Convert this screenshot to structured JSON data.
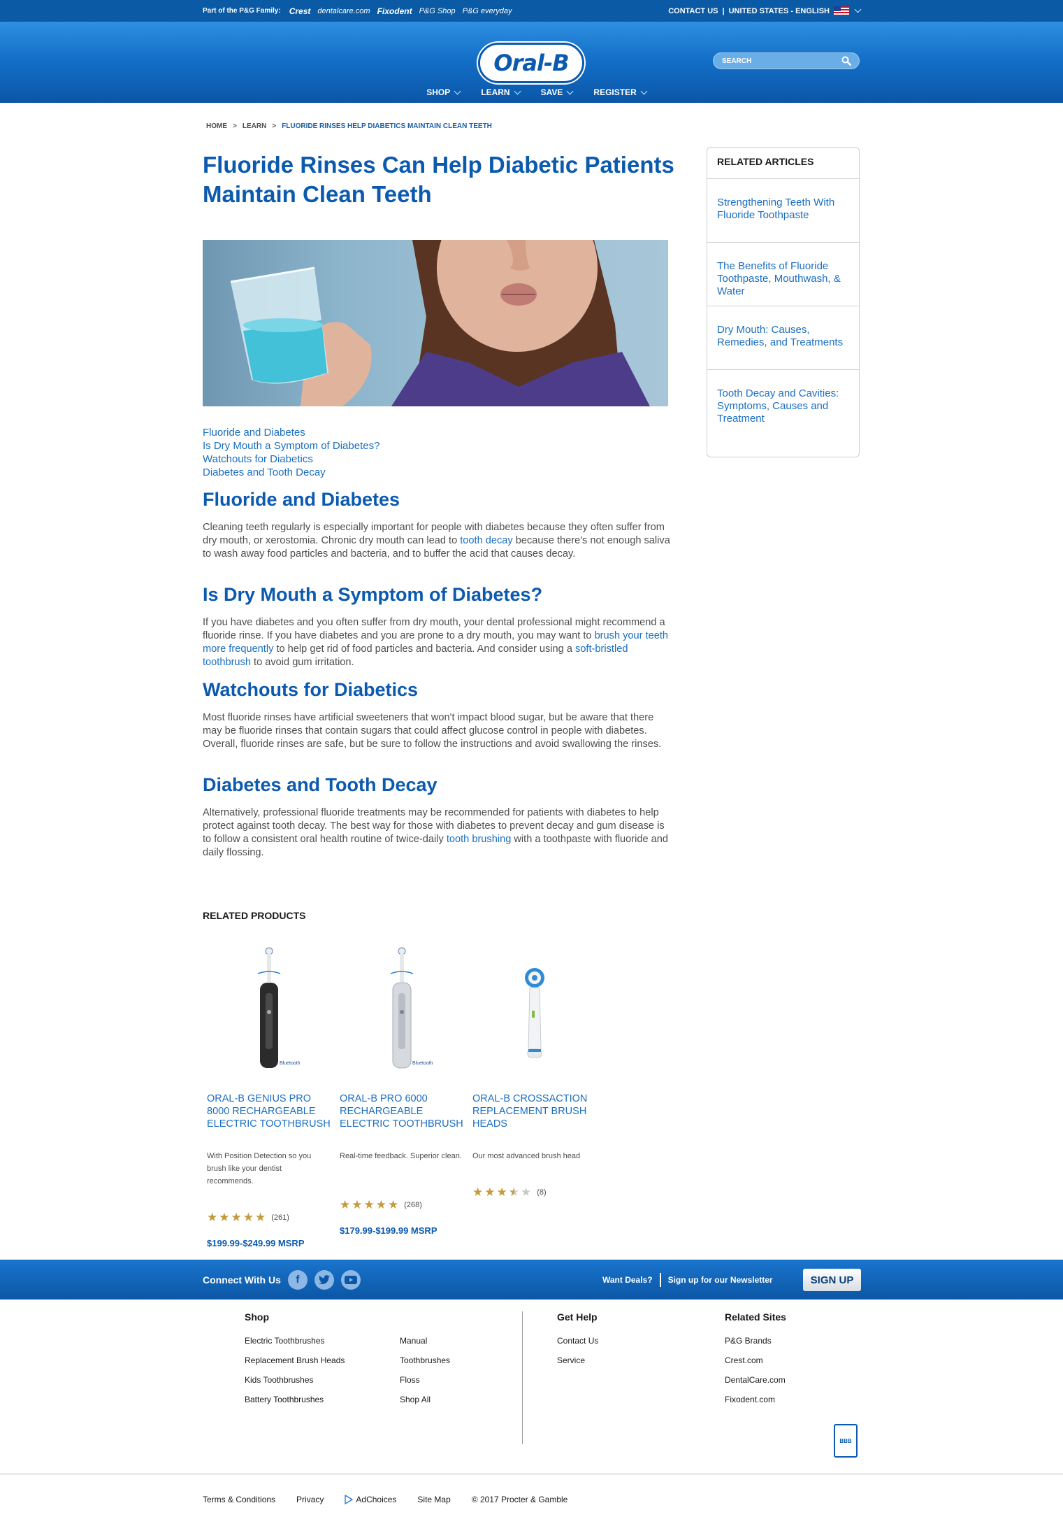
{
  "pg_bar": {
    "family_label": "Part of the P&G Family:",
    "brands": [
      "Crest",
      "dentalcare.com",
      "Fixodent",
      "P&G Shop",
      "P&G everyday"
    ],
    "contact": "CONTACT US",
    "locale": "UNITED STATES - ENGLISH",
    "separator": "|"
  },
  "header": {
    "logo": "Oral-B",
    "search_placeholder": "SEARCH",
    "nav": [
      "SHOP",
      "LEARN",
      "SAVE",
      "REGISTER"
    ]
  },
  "breadcrumb": {
    "items": [
      "HOME",
      "LEARN",
      "FLUORIDE RINSES HELP DIABETICS MAINTAIN CLEAN TEETH"
    ],
    "separator": ">"
  },
  "article": {
    "title": "Fluoride Rinses Can Help Diabetic Patients Maintain Clean Teeth",
    "toc": [
      "Fluoride and Diabetes",
      "Is Dry Mouth a Symptom of Diabetes?",
      "Watchouts for Diabetics",
      "Diabetes and Tooth Decay"
    ],
    "sections": [
      {
        "heading": "Fluoride and Diabetes",
        "p1": "Cleaning teeth regularly is especially important for people with diabetes because they often suffer from dry mouth, or xerostomia. Chronic dry mouth can lead to ",
        "link1": "tooth decay",
        "p2": " because there's not enough saliva to wash away food particles and bacteria, and to buffer the acid that causes decay."
      },
      {
        "heading": "Is Dry Mouth a Symptom of Diabetes?",
        "p1": "If you have diabetes and you often suffer from dry mouth, your dental professional might recommend a fluoride rinse. If you have diabetes and you are prone to a dry mouth, you may want to ",
        "link1": "brush your teeth more frequently",
        "p2": " to help get rid of food particles and bacteria. And consider using a ",
        "link2": "soft-bristled toothbrush",
        "p3": " to avoid gum irritation."
      },
      {
        "heading": "Watchouts for Diabetics",
        "p1": "Most fluoride rinses have artificial sweeteners that won't impact blood sugar, but be aware that there may be fluoride rinses that contain sugars that could affect glucose control in people with diabetes. Overall, fluoride rinses are safe, but be sure to follow the instructions and avoid swallowing the rinses."
      },
      {
        "heading": "Diabetes and Tooth Decay",
        "p1": "Alternatively, professional fluoride treatments may be recommended for patients with diabetes to help protect against tooth decay. The best way for those with diabetes to prevent decay and gum disease is to follow a consistent oral health routine of twice-daily ",
        "link1": "tooth brushing",
        "p2": " with a toothpaste with fluoride and daily flossing."
      }
    ]
  },
  "related_articles": {
    "title": "RELATED ARTICLES",
    "items": [
      "Strengthening Teeth With Fluoride Toothpaste",
      "The Benefits of Fluoride Toothpaste, Mouthwash, & Water",
      "Dry Mouth: Causes, Remedies, and Treatments",
      "Tooth Decay and Cavities: Symptoms, Causes and Treatment"
    ]
  },
  "related_products": {
    "title": "RELATED PRODUCTS",
    "items": [
      {
        "name": "ORAL-B GENIUS PRO 8000 RECHARGEABLE ELECTRIC TOOTHBRUSH",
        "desc": "With Position Detection so you brush like your dentist recommends.",
        "rating": 5,
        "count": "(261)",
        "price": "$199.99-$249.99 MSRP",
        "badge": "Bluetooth",
        "color": "#2b2b2b"
      },
      {
        "name": "ORAL-B PRO 6000 RECHARGEABLE ELECTRIC TOOTHBRUSH",
        "desc": "Real-time feedback. Superior clean.",
        "rating": 5,
        "count": "(268)",
        "price": "$179.99-$199.99 MSRP",
        "badge": "Bluetooth",
        "color": "#c9ced4"
      },
      {
        "name": "ORAL-B CROSSACTION REPLACEMENT BRUSH HEADS",
        "desc": "Our most advanced brush head",
        "rating": 3.5,
        "count": "(8)",
        "price": ""
      }
    ]
  },
  "footer_bar": {
    "connect": "Connect With Us",
    "social": [
      "facebook-icon",
      "twitter-icon",
      "youtube-icon"
    ],
    "want_deals": "Want Deals?",
    "newsletter": "Sign up for our Newsletter",
    "signup": "SIGN UP"
  },
  "footer": {
    "shop_title": "Shop",
    "shop_col1": [
      "Electric Toothbrushes",
      "Replacement Brush Heads",
      "Kids Toothbrushes",
      "Battery Toothbrushes"
    ],
    "shop_col2": [
      "Manual",
      "Toothbrushes",
      "Floss",
      "Shop All"
    ],
    "help_title": "Get Help",
    "help": [
      "Contact Us",
      "Service"
    ],
    "sites_title": "Related Sites",
    "sites": [
      "P&G Brands",
      "Crest.com",
      "DentalCare.com",
      "Fixodent.com"
    ],
    "bbb": "BBB",
    "bottom": [
      "Terms & Conditions",
      "Privacy",
      "AdChoices",
      "Site Map",
      "© 2017 Procter & Gamble"
    ]
  }
}
